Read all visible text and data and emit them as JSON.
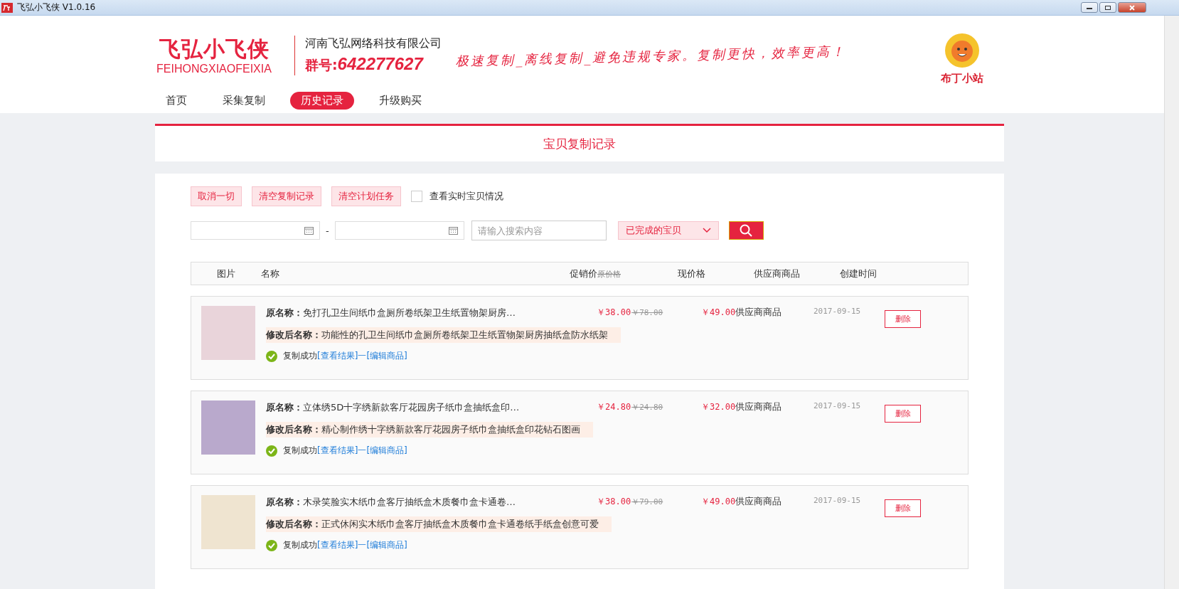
{
  "window": {
    "title": "飞弘小飞侠 V1.0.16"
  },
  "header": {
    "logo_title": "飞弘小飞侠",
    "logo_subtitle": "FEIHONGXIAOFEIXIA",
    "company": "河南飞弘网络科技有限公司",
    "group_label": "群号:",
    "group_number": "642277627",
    "slogan": "极速复制_离线复制_避免违规专家。复制更快，效率更高！",
    "user_name": "布丁小站"
  },
  "nav": [
    {
      "label": "首页",
      "selected": false
    },
    {
      "label": "采集复制",
      "selected": false
    },
    {
      "label": "历史记录",
      "selected": true
    },
    {
      "label": "升级购买",
      "selected": false
    }
  ],
  "page_title": "宝贝复制记录",
  "actions": [
    "取消一切",
    "清空复制记录",
    "清空计划任务"
  ],
  "realtime_checkbox": {
    "label": "查看实时宝贝情况",
    "checked": false
  },
  "filters": {
    "range_separator": "-",
    "search": {
      "placeholder": "请输入搜索内容"
    },
    "status_select": "已完成的宝贝"
  },
  "table": {
    "columns": [
      {
        "label": "图片"
      },
      {
        "label": "名称"
      },
      {
        "label": "促销价",
        "secondary": "原价格"
      },
      {
        "label": "现价格"
      },
      {
        "label": "供应商商品"
      },
      {
        "label": "创建时间"
      }
    ],
    "rows": [
      {
        "original_label": "原名称：",
        "original_name": "免打孔卫生间纸巾盒厕所卷纸架卫生纸置物架厨房…",
        "modified_label": "修改后名称：",
        "modified_name": "功能性的孔卫生间纸巾盒厕所卷纸架卫生纸置物架厨房抽纸盒防水纸架",
        "status": "复制成功",
        "view_link": "[查看结果]",
        "link_separator": "一",
        "edit_link": "[编辑商品]",
        "promo_price": "￥38.00",
        "original_price": "￥78.00",
        "current_price": "￥49.00",
        "supplier": "供应商商品",
        "created": "2017-09-15",
        "delete": "删除"
      },
      {
        "original_label": "原名称：",
        "original_name": "立体绣5D十字绣新款客厅花园房子纸巾盒抽纸盒印…",
        "modified_label": "修改后名称：",
        "modified_name": "精心制作绣十字绣新款客厅花园房子纸巾盒抽纸盒印花钻石图画",
        "status": "复制成功",
        "view_link": "[查看结果]",
        "link_separator": "一",
        "edit_link": "[编辑商品]",
        "promo_price": "￥24.80",
        "original_price": "￥24.80",
        "current_price": "￥32.00",
        "supplier": "供应商商品",
        "created": "2017-09-15",
        "delete": "删除"
      },
      {
        "original_label": "原名称：",
        "original_name": "木录笑脸实木纸巾盒客厅抽纸盒木质餐巾盒卡通卷…",
        "modified_label": "修改后名称：",
        "modified_name": "正式休闲实木纸巾盒客厅抽纸盒木质餐巾盒卡通卷纸手纸盒创意可爱",
        "status": "复制成功",
        "view_link": "[查看结果]",
        "link_separator": "一",
        "edit_link": "[编辑商品]",
        "promo_price": "￥38.00",
        "original_price": "￥79.00",
        "current_price": "￥49.00",
        "supplier": "供应商商品",
        "created": "2017-09-15",
        "delete": "删除"
      }
    ]
  }
}
